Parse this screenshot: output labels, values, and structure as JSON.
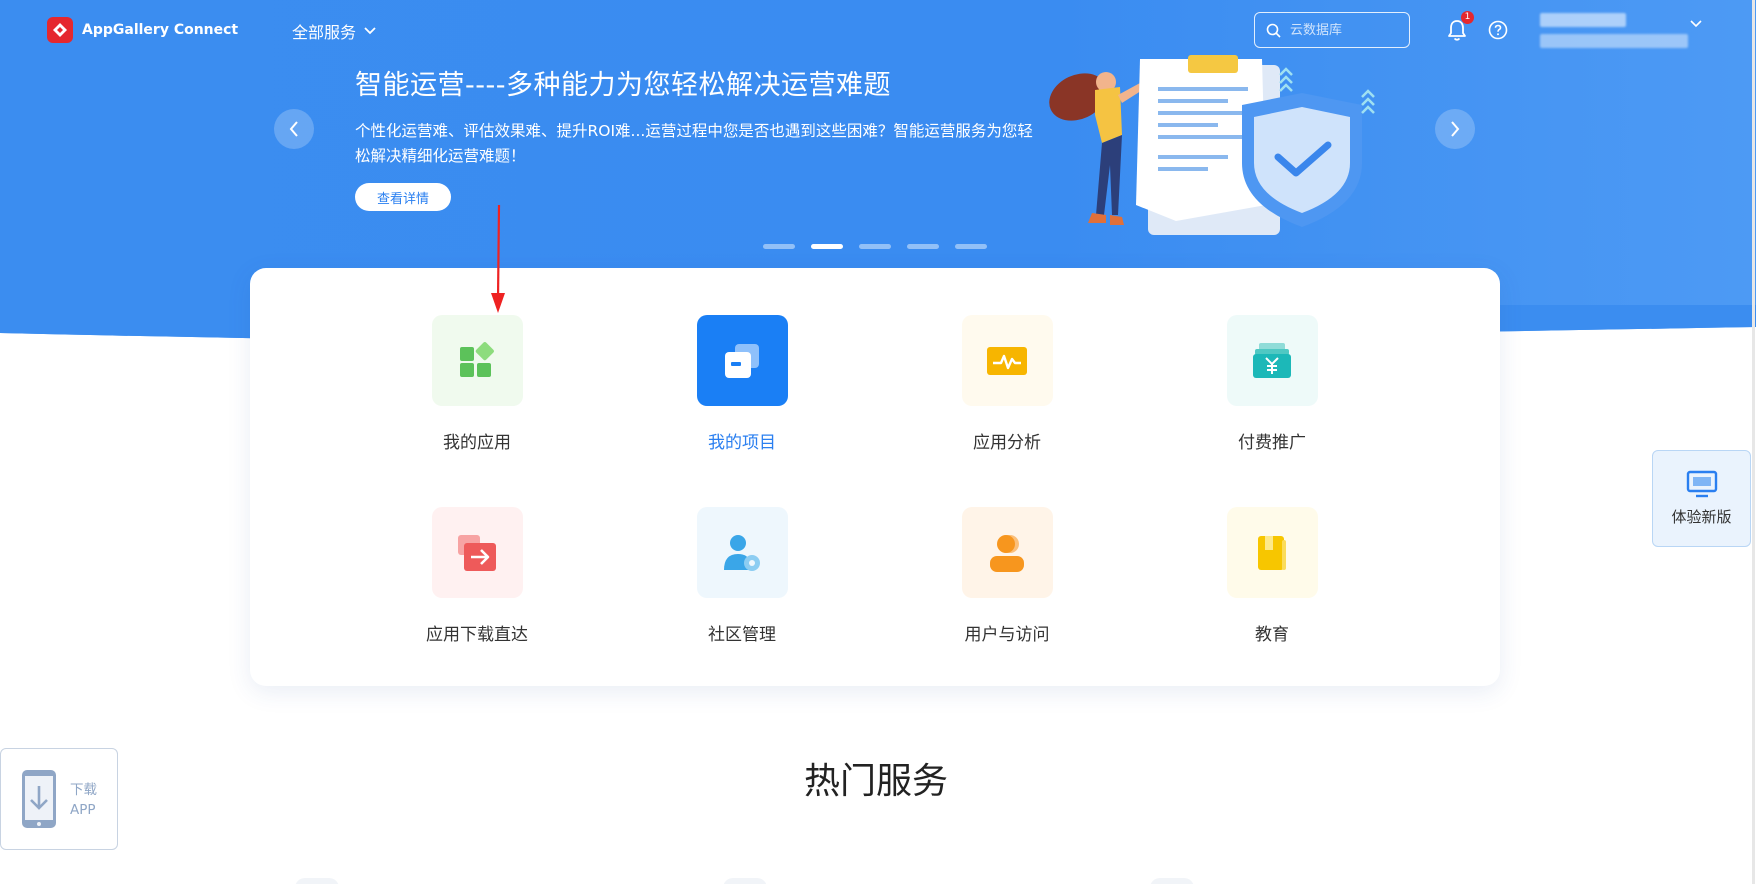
{
  "app": {
    "name": "AppGallery Connect"
  },
  "topnav": {
    "all_services": "全部服务",
    "search_placeholder": "云数据库",
    "notification_count": "1"
  },
  "banner": {
    "title": "智能运营----多种能力为您轻松解决运营难题",
    "description": "个性化运营难、评估效果难、提升ROI难...运营过程中您是否也遇到这些困难？智能运营服务为您轻松解决精细化运营难题！",
    "detail_button": "查看详情",
    "slide_count": 5,
    "active_slide": 2
  },
  "services": [
    {
      "label": "我的应用",
      "icon": "app-grid-icon",
      "color": "#5cc25a",
      "bg": "#f0faee"
    },
    {
      "label": "我的项目",
      "icon": "project-icon",
      "color": "#ffffff",
      "bg": "#1a7ff5",
      "active": true
    },
    {
      "label": "应用分析",
      "icon": "analysis-icon",
      "color": "#f7b500",
      "bg": "#fffaee"
    },
    {
      "label": "付费推广",
      "icon": "paid-promotion-icon",
      "color": "#1cb8b8",
      "bg": "#eefaf9"
    },
    {
      "label": "应用下载直达",
      "icon": "download-direct-icon",
      "color": "#ee5a5a",
      "bg": "#fff1f1"
    },
    {
      "label": "社区管理",
      "icon": "community-icon",
      "color": "#3aa6e8",
      "bg": "#eef7fd"
    },
    {
      "label": "用户与访问",
      "icon": "user-access-icon",
      "color": "#f7961e",
      "bg": "#fff4e8"
    },
    {
      "label": "教育",
      "icon": "education-icon",
      "color": "#f7c600",
      "bg": "#fffbea"
    }
  ],
  "floating": {
    "new_version": "体验新版",
    "download_line1": "下载",
    "download_line2": "APP"
  },
  "section": {
    "title": "热门服务"
  },
  "colors": {
    "primary": "#2a7ff0",
    "banner": "#3b8df0",
    "badge": "#e5282e"
  }
}
